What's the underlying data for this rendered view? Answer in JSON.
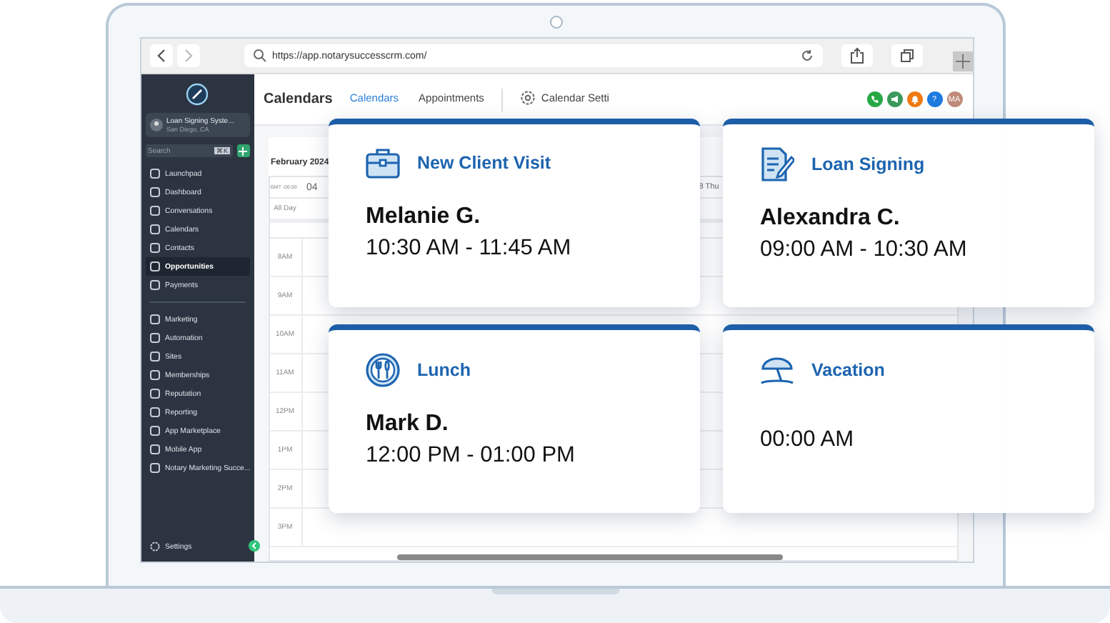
{
  "browser": {
    "url": "https://app.notarysuccesscrm.com/"
  },
  "sidebar": {
    "account": {
      "name": "Loan Signing Syste...",
      "location": "San Diego, CA"
    },
    "search": {
      "placeholder": "Search",
      "shortcut": "⌘K"
    },
    "groups": [
      [
        {
          "label": "Launchpad",
          "selected": false
        },
        {
          "label": "Dashboard",
          "selected": false
        },
        {
          "label": "Conversations",
          "selected": false
        },
        {
          "label": "Calendars",
          "selected": false
        },
        {
          "label": "Contacts",
          "selected": false
        },
        {
          "label": "Opportunities",
          "selected": true
        },
        {
          "label": "Payments",
          "selected": false
        }
      ],
      [
        {
          "label": "Marketing",
          "selected": false
        },
        {
          "label": "Automation",
          "selected": false
        },
        {
          "label": "Sites",
          "selected": false
        },
        {
          "label": "Memberships",
          "selected": false
        },
        {
          "label": "Reputation",
          "selected": false
        },
        {
          "label": "Reporting",
          "selected": false
        },
        {
          "label": "App Marketplace",
          "selected": false
        },
        {
          "label": "Mobile App",
          "selected": false
        },
        {
          "label": "Notary Marketing Succe...",
          "selected": false
        }
      ]
    ],
    "settings": "Settings"
  },
  "header": {
    "title": "Calendars",
    "tabs": [
      {
        "label": "Calendars",
        "selected": true
      },
      {
        "label": "Appointments",
        "selected": false
      }
    ],
    "settings_tab": "Calendar Setti",
    "actions": [
      {
        "kind": "phone",
        "color": "#27a844"
      },
      {
        "kind": "megaphone",
        "color": "#3a9a5b"
      },
      {
        "kind": "bell",
        "color": "#f07a12"
      },
      {
        "kind": "help",
        "color": "#1e7be0",
        "text": "?"
      },
      {
        "kind": "avatar",
        "color": "#c08a7a",
        "text": "MA"
      }
    ]
  },
  "calendar": {
    "month": "February 2024",
    "timezone": "GMT -06:00",
    "day": "04",
    "all_day": "All Day",
    "column_header": "8 Thu",
    "times": [
      "8AM",
      "9AM",
      "10AM",
      "11AM",
      "12PM",
      "1PM",
      "2PM",
      "3PM"
    ]
  },
  "cards": [
    {
      "kind": "briefcase",
      "title": "New Client Visit",
      "name": "Melanie G.",
      "time": "10:30 AM - 11:45 AM"
    },
    {
      "kind": "document",
      "title": "Loan Signing",
      "name": "Alexandra C.",
      "time": "09:00 AM - 10:30 AM"
    },
    {
      "kind": "plate",
      "title": "Lunch",
      "name": "Mark D.",
      "time": "12:00 PM - 01:00 PM"
    },
    {
      "kind": "umbrella",
      "title": "Vacation",
      "time": "00:00 AM"
    }
  ]
}
